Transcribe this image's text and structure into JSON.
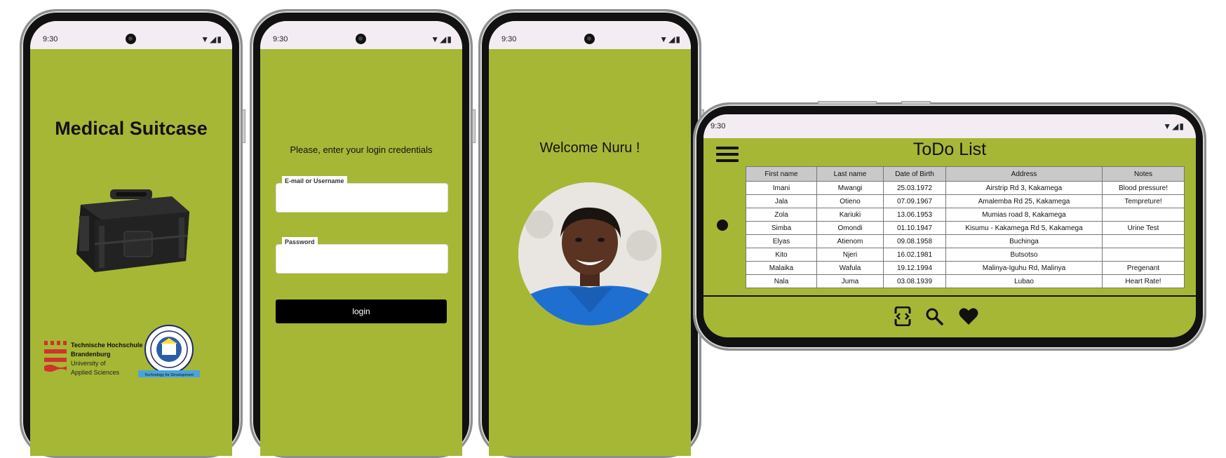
{
  "status": {
    "time": "9:30",
    "system_icons": "▼◢▮"
  },
  "screen1": {
    "title": "Medical Suitcase",
    "thb": {
      "line1": "Technische Hochschule",
      "line2": "Brandenburg",
      "line3": "University of",
      "line4": "Applied Sciences"
    },
    "mmust": {
      "ring_text": "MASINDE MULIRO UNIVERSITY OF SCIENCE AND TECHNOLOGY",
      "banner": "Technology for Development"
    }
  },
  "screen2": {
    "prompt": "Please, enter your login credentials",
    "email_label": "E-mail or Username",
    "password_label": "Password",
    "login_label": "login"
  },
  "screen3": {
    "welcome": "Welcome Nuru !"
  },
  "todo": {
    "title": "ToDo List",
    "columns": [
      "First name",
      "Last name",
      "Date of Birth",
      "Address",
      "Notes"
    ],
    "rows": [
      [
        "Imani",
        "Mwangi",
        "25.03.1972",
        "Airstrip Rd 3,  Kakamega",
        "Blood pressure!"
      ],
      [
        "Jala",
        "Otieno",
        "07.09.1967",
        "Amalemba Rd 25, Kakamega",
        "Tempreture!"
      ],
      [
        "Zola",
        "Kariuki",
        "13.06.1953",
        "Mumias road 8,  Kakamega",
        ""
      ],
      [
        "Simba",
        "Omondi",
        "01.10.1947",
        "Kisumu - Kakamega Rd 5, Kakamega",
        "Urine Test"
      ],
      [
        "Elyas",
        "Atienom",
        "09.08.1958",
        "Buchinga",
        ""
      ],
      [
        "Kito",
        "Njeri",
        "16.02.1981",
        "Butsotso",
        ""
      ],
      [
        "Malaika",
        "Wafula",
        "19.12.1994",
        "Malinya-Iguhu Rd,  Malinya",
        "Pregenant"
      ],
      [
        "Nala",
        "Juma",
        "03.08.1939",
        "Lubao",
        "Heart Rate!"
      ]
    ],
    "bottom_nav": [
      "scan-icon",
      "search-icon",
      "heart-icon"
    ]
  },
  "colors": {
    "screen_bg": "#a6b736",
    "status_bg": "#f3edf3",
    "button": "#000000"
  }
}
